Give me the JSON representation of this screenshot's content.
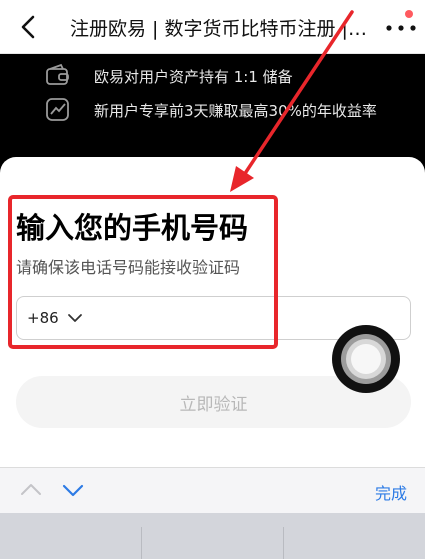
{
  "header": {
    "back_icon": "chevron-left-icon",
    "title": "注册欧易 | 数字货币比特币注册 | 数字货币交易所 …",
    "more_icon": "more-horizontal-icon",
    "notification_color": "#ff5a5f"
  },
  "features": [
    {
      "icon": "wallet-icon",
      "text": "欧易对用户资产持有 1:1 储备"
    },
    {
      "icon": "growth-chart-icon",
      "text": "新用户专享前3天赚取最高30%的年收益率"
    }
  ],
  "form": {
    "heading": "输入您的手机号码",
    "subheading": "请确保该电话号码能接收验证码",
    "country_code": "+86",
    "phone_value": "",
    "submit_label": "立即验证"
  },
  "keyboard_toolbar": {
    "prev_icon": "chevron-up-icon",
    "next_icon": "chevron-down-icon",
    "done_label": "完成"
  },
  "colors": {
    "annotation_red": "#e8262b",
    "done_blue": "#2d7be5",
    "dark_banner": "#000000"
  }
}
